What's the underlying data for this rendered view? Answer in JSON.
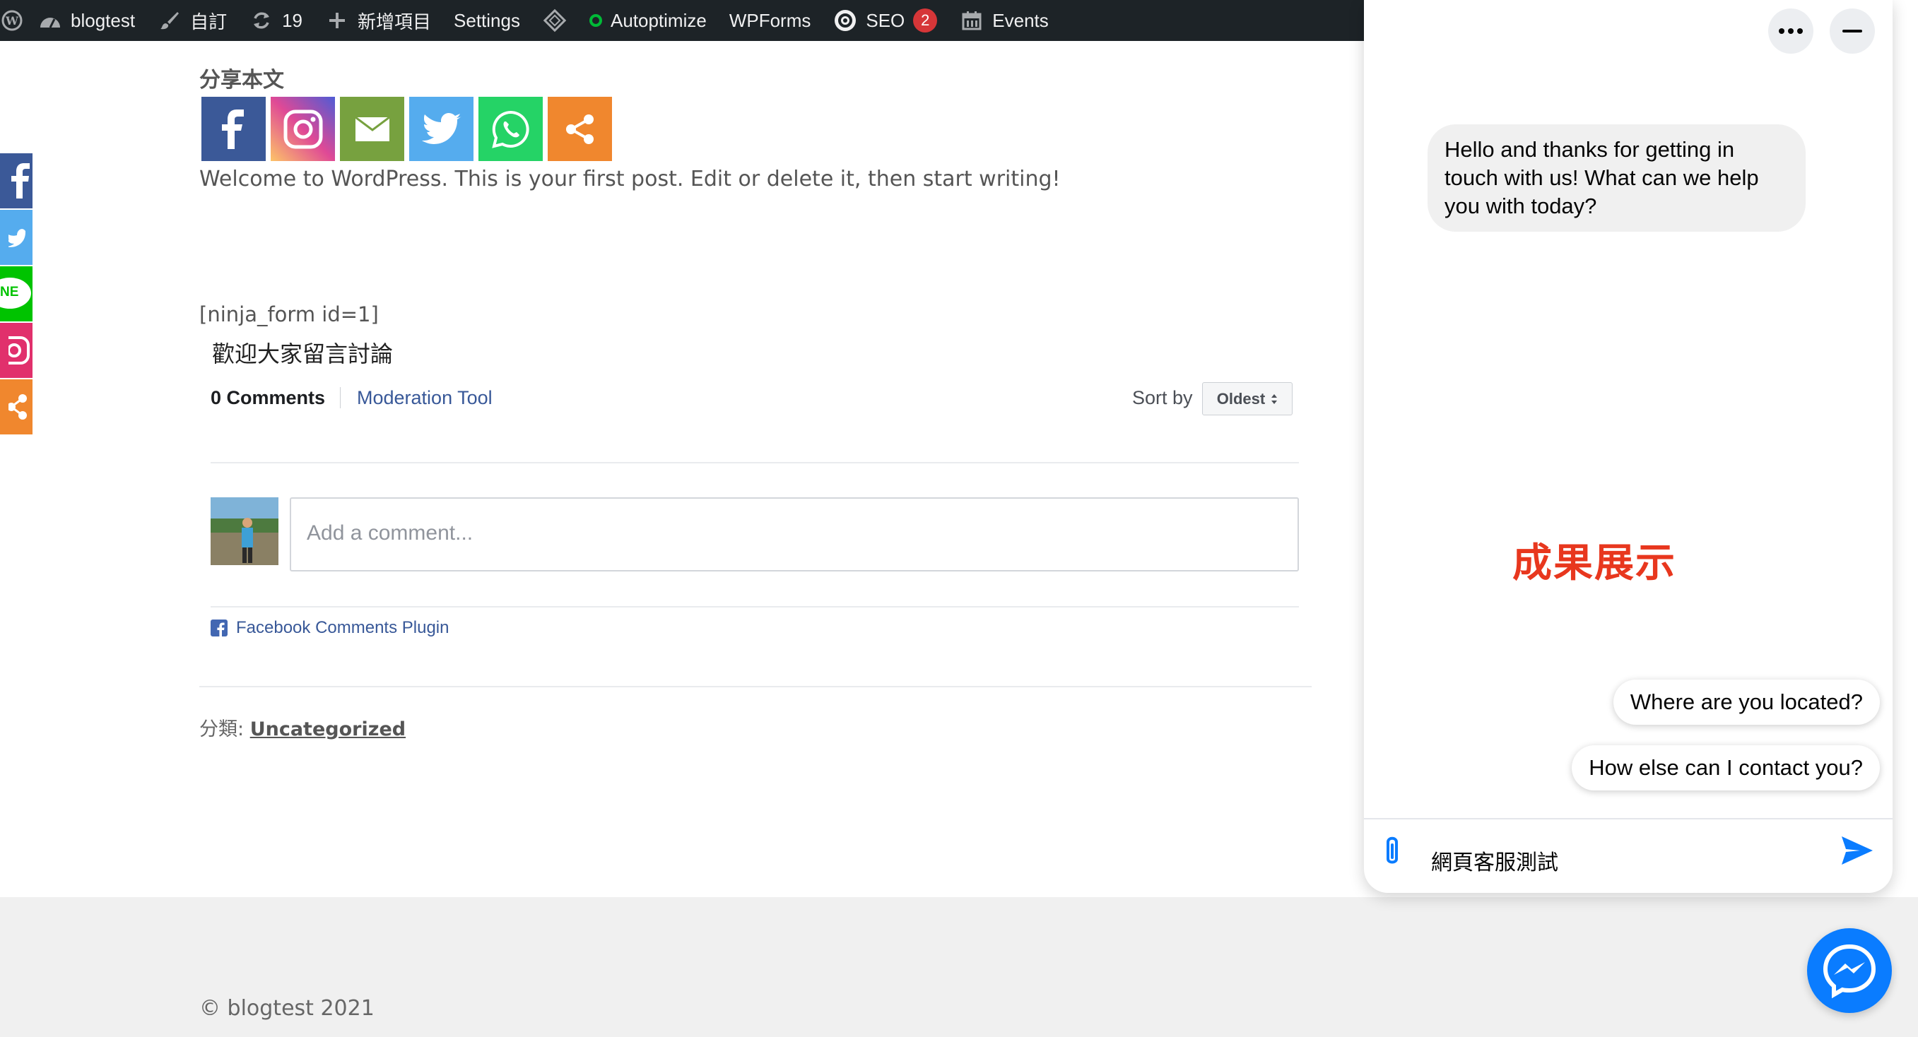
{
  "adminbar": {
    "site_name": "blogtest",
    "customize": "自訂",
    "updates_count": "19",
    "new_item": "新增項目",
    "settings": "Settings",
    "autoptimize": "Autoptimize",
    "wpforms": "WPForms",
    "seo": "SEO",
    "seo_badge": "2",
    "events": "Events"
  },
  "floatbar": {
    "items": [
      {
        "icon": "facebook-icon",
        "color": "#3b5998",
        "label": "f"
      },
      {
        "icon": "twitter-icon",
        "color": "#55acee",
        "label": ""
      },
      {
        "icon": "line-icon",
        "color": "#00c300",
        "label": "NE"
      },
      {
        "icon": "instagram-icon",
        "color": "#e1306c",
        "label": ""
      },
      {
        "icon": "share-icon",
        "color": "#f0872e",
        "label": ""
      }
    ]
  },
  "post": {
    "share_heading": "分享本文",
    "share_buttons": [
      {
        "icon": "facebook-icon",
        "color": "#3b5998"
      },
      {
        "icon": "instagram-icon",
        "color": "#c13584"
      },
      {
        "icon": "email-icon",
        "color": "#77a13f"
      },
      {
        "icon": "twitter-icon",
        "color": "#55acee"
      },
      {
        "icon": "whatsapp-icon",
        "color": "#25d366"
      },
      {
        "icon": "share-icon",
        "color": "#f0872e"
      }
    ],
    "body": "Welcome to WordPress. This is your first post. Edit or delete it, then start writing!",
    "shortcode": "[ninja_form id=1]",
    "discussion": "歡迎大家留言討論",
    "category_label": "分類: ",
    "category": "Uncategorized"
  },
  "comments": {
    "count_label": "0 Comments",
    "moderation": "Moderation Tool",
    "sort_label": "Sort by",
    "sort_value": "Oldest",
    "placeholder": "Add a comment...",
    "plugin_label": "Facebook Comments Plugin"
  },
  "chat": {
    "welcome": "Hello and thanks for getting in touch with us! What can we help you with today?",
    "annotation": "成果展示",
    "quick_replies": [
      "Where are you located?",
      "How else can I contact you?"
    ],
    "input_value": "網頁客服測試"
  },
  "footer": {
    "copyright": "© blogtest 2021"
  },
  "colors": {
    "adminbar": "#1d2327",
    "messenger": "#0a7cff",
    "annotation": "#e8371e",
    "link": "#385898"
  }
}
